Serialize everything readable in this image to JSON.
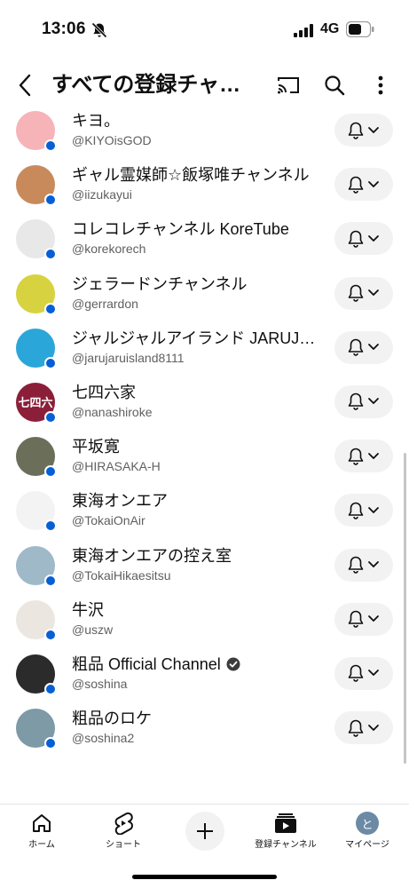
{
  "status_bar": {
    "time": "13:06",
    "network": "4G",
    "icons": [
      "bell-off-icon",
      "signal-icon",
      "battery-icon"
    ]
  },
  "header": {
    "title": "すべての登録チャ…",
    "icons": [
      "back-icon",
      "cast-icon",
      "search-icon",
      "more-vert-icon"
    ]
  },
  "channels": [
    {
      "name": "キヨ。",
      "handle": "@KIYOisGOD",
      "avatar_color": "#f6b3b8",
      "avatar_text": "",
      "verified": false
    },
    {
      "name": "ギャル霊媒師☆飯塚唯チャンネル",
      "handle": "@iizukayui",
      "avatar_color": "#c98a5b",
      "avatar_text": "",
      "verified": false
    },
    {
      "name": "コレコレチャンネル KoreTube",
      "handle": "@korekorech",
      "avatar_color": "#e8e8e8",
      "avatar_text": "",
      "verified": false
    },
    {
      "name": "ジェラードンチャンネル",
      "handle": "@gerrardon",
      "avatar_color": "#d7d23f",
      "avatar_text": "",
      "verified": false
    },
    {
      "name": "ジャルジャルアイランド JARUJ…",
      "handle": "@jarujaruisland8111",
      "avatar_color": "#2aa6d9",
      "avatar_text": "",
      "verified": false
    },
    {
      "name": "七四六家",
      "handle": "@nanashiroke",
      "avatar_color": "#8b1f3a",
      "avatar_text": "七四六",
      "verified": false
    },
    {
      "name": "平坂寛",
      "handle": "@HIRASAKA-H",
      "avatar_color": "#6b6f5a",
      "avatar_text": "",
      "verified": false
    },
    {
      "name": "東海オンエア",
      "handle": "@TokaiOnAir",
      "avatar_color": "#f3f3f3",
      "avatar_text": "",
      "verified": false
    },
    {
      "name": "東海オンエアの控え室",
      "handle": "@TokaiHikaesitsu",
      "avatar_color": "#9fb9c9",
      "avatar_text": "",
      "verified": false
    },
    {
      "name": "牛沢",
      "handle": "@uszw",
      "avatar_color": "#ebe6df",
      "avatar_text": "",
      "verified": false
    },
    {
      "name": "粗品 Official Channel",
      "handle": "@soshina",
      "avatar_color": "#2b2b2b",
      "avatar_text": "",
      "verified": true
    },
    {
      "name": "粗品のロケ",
      "handle": "@soshina2",
      "avatar_color": "#7d9aa6",
      "avatar_text": "",
      "verified": false
    }
  ],
  "bottom_nav": {
    "home": "ホーム",
    "shorts": "ショート",
    "subscriptions": "登録チャンネル",
    "me": "マイページ",
    "me_avatar_initial": "と"
  },
  "colors": {
    "accent_blue": "#065fd4",
    "pill_bg": "#f2f2f2",
    "secondary_text": "#606060"
  }
}
